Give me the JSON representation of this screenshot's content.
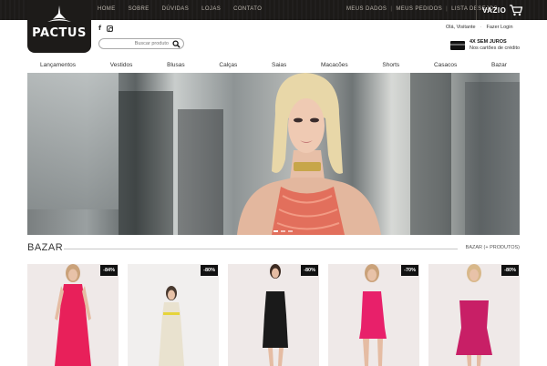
{
  "top_nav": [
    "HOME",
    "SOBRE",
    "DÚVIDAS",
    "LOJAS",
    "CONTATO"
  ],
  "user_nav": [
    "MEUS DADOS",
    "MEUS PEDIDOS",
    "LISTA DESEJOS"
  ],
  "cart": {
    "label": "VAZIO",
    "icon": "shopping-cart-icon"
  },
  "logo": {
    "text": "PACTUS",
    "icon": "tower-logo-icon"
  },
  "social": {
    "facebook": "f",
    "instagram_icon": "instagram-icon"
  },
  "search": {
    "placeholder": "Buscar produto",
    "icon": "search-icon"
  },
  "greeting": {
    "hello": "Olá, Visitante",
    "login": "Fazer Login"
  },
  "promo": {
    "line1": "4X SEM JUROS",
    "line2": "Nos cartões de crédito",
    "icon": "credit-card-icon"
  },
  "categories": [
    "Lançamentos",
    "Vestidos",
    "Blusas",
    "Calças",
    "Saias",
    "Macacões",
    "Shorts",
    "Casacos",
    "Bazar"
  ],
  "bazar": {
    "title": "BAZAR",
    "link": "BAZAR (+ PRODUTOS)",
    "products": [
      {
        "discount": "-84%",
        "dress_color": "#e8205a"
      },
      {
        "discount": "-80%",
        "dress_color": "#e9e2cf"
      },
      {
        "discount": "-80%",
        "dress_color": "#1a1a1a"
      },
      {
        "discount": "-70%",
        "dress_color": "#e8206a"
      },
      {
        "discount": "-80%",
        "dress_color": "#c81f66"
      }
    ]
  },
  "colors": {
    "topbar": "#1d1b19",
    "accent": "#111111"
  }
}
